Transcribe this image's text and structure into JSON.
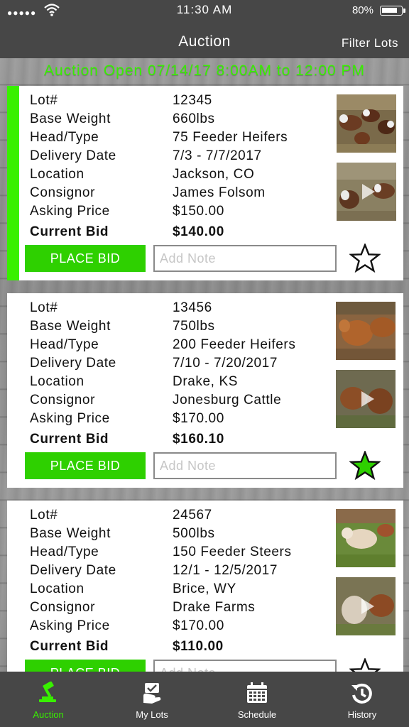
{
  "status_bar": {
    "signal": "●●●●●",
    "time": "11:30 AM",
    "battery": "80%"
  },
  "nav": {
    "title": "Auction",
    "filter": "Filter Lots"
  },
  "banner": "Auction Open 07/14/17  8:00AM to 12:00 PM",
  "field_labels": {
    "lot": "Lot#",
    "base_weight": "Base Weight",
    "head_type": "Head/Type",
    "delivery_date": "Delivery Date",
    "location": "Location",
    "consignor": "Consignor",
    "asking_price": "Asking Price",
    "current_bid": "Current Bid"
  },
  "lots": [
    {
      "lot": "12345",
      "base_weight": "660lbs",
      "head_type": "75 Feeder Heifers",
      "delivery_date": "7/3 - 7/7/2017",
      "location": "Jackson, CO",
      "consignor": "James Folsom",
      "asking_price": "$150.00",
      "current_bid": "$140.00",
      "bid_label": "PLACE BID",
      "note_placeholder": "Add Note",
      "favorited": false,
      "selected": true
    },
    {
      "lot": "13456",
      "base_weight": "750lbs",
      "head_type": "200 Feeder Heifers",
      "delivery_date": "7/10 - 7/20/2017",
      "location": "Drake, KS",
      "consignor": "Jonesburg Cattle",
      "asking_price": "$170.00",
      "current_bid": "$160.10",
      "bid_label": "PLACE BID",
      "note_placeholder": "Add Note",
      "favorited": true,
      "selected": false
    },
    {
      "lot": "24567",
      "base_weight": "500lbs",
      "head_type": "150 Feeder Steers",
      "delivery_date": "12/1 - 12/5/2017",
      "location": "Brice, WY",
      "consignor": "Drake Farms",
      "asking_price": "$170.00",
      "current_bid": "$110.00",
      "bid_label": "PLACE BID",
      "note_placeholder": "Add Note",
      "favorited": false,
      "selected": false
    }
  ],
  "tabs": [
    {
      "label": "Auction",
      "icon": "gavel-icon",
      "active": true
    },
    {
      "label": "My Lots",
      "icon": "my-lots-icon",
      "active": false
    },
    {
      "label": "Schedule",
      "icon": "calendar-icon",
      "active": false
    },
    {
      "label": "History",
      "icon": "history-icon",
      "active": false
    }
  ],
  "colors": {
    "accent_green": "#38f000",
    "button_green": "#2ed000",
    "bar_gray": "#474747"
  }
}
